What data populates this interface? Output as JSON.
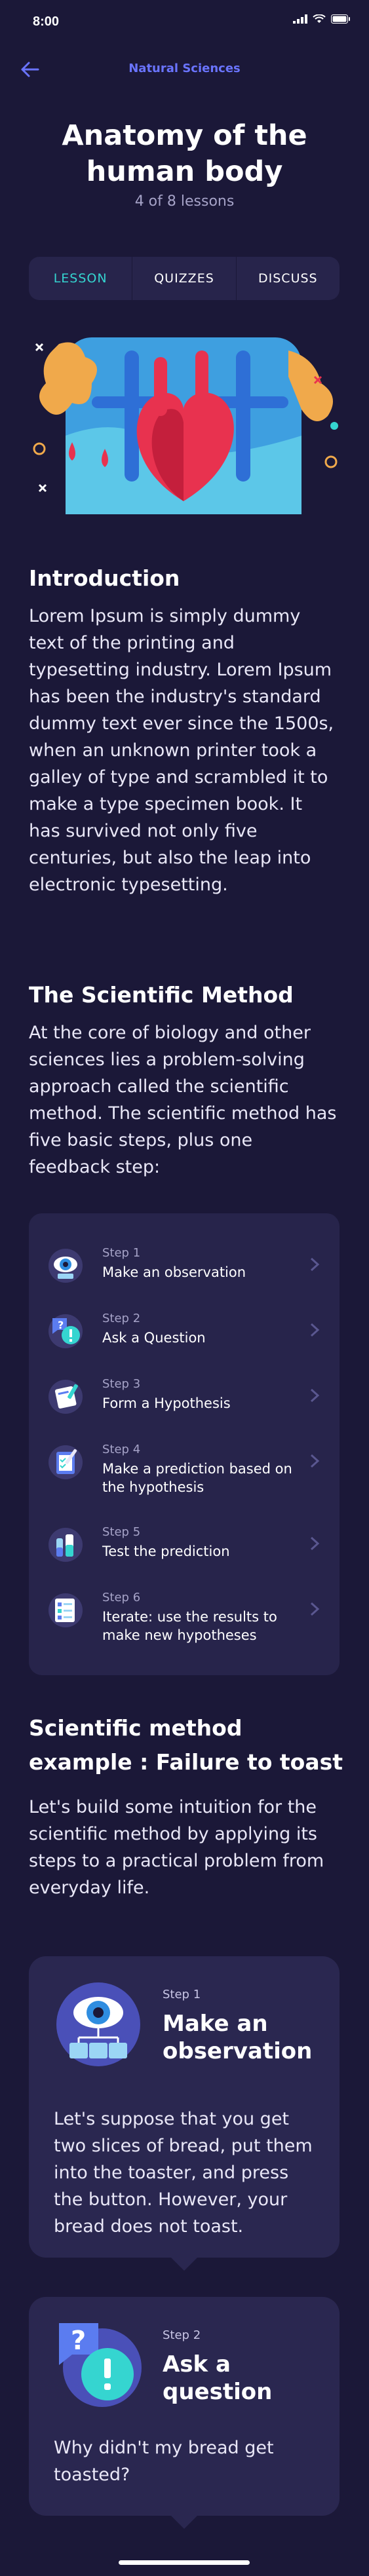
{
  "status_bar": {
    "time": "8:00"
  },
  "nav": {
    "title": "Natural Sciences"
  },
  "lesson": {
    "title": "Anatomy of the human body",
    "progress": "4 of 8 lessons"
  },
  "tabs": [
    {
      "label": "LESSON",
      "active": true
    },
    {
      "label": "QUIZZES",
      "active": false
    },
    {
      "label": "DISCUSS",
      "active": false
    }
  ],
  "intro": {
    "heading": "Introduction",
    "body": "Lorem Ipsum is simply dummy text of the printing and typesetting industry. Lorem Ipsum has been the industry's standard dummy text ever since the 1500s, when an unknown printer took a galley of type and scrambled it to make a type specimen book. It has survived not only five centuries, but also the leap into electronic typesetting."
  },
  "method": {
    "heading": "The Scientific Method",
    "body": "At the core of biology and other sciences lies a problem-solving approach called the scientific method. The scientific method has five basic steps, plus one feedback step:",
    "steps": [
      {
        "label": "Step 1",
        "text": "Make an observation",
        "icon": "eye-icon"
      },
      {
        "label": "Step 2",
        "text": "Ask a Question",
        "icon": "question-icon"
      },
      {
        "label": "Step 3",
        "text": "Form a Hypothesis",
        "icon": "notebook-icon"
      },
      {
        "label": "Step 4",
        "text": "Make a prediction based on the hypothesis",
        "icon": "checklist-icon"
      },
      {
        "label": "Step 5",
        "text": "Test the prediction",
        "icon": "flask-icon"
      },
      {
        "label": "Step 6",
        "text": "Iterate: use the results to make new hypotheses",
        "icon": "report-icon"
      }
    ]
  },
  "example": {
    "heading": "Scientific method example : Failure to toast",
    "body": "Let's build some intuition for the scientific method by applying its steps to a practical problem from everyday life.",
    "cards": [
      {
        "step": "Step 1",
        "title": "Make an observation",
        "body": "Let's suppose that you get two slices of bread, put them into the toaster, and press the button. However, your bread does not toast."
      },
      {
        "step": "Step 2",
        "title": "Ask a question",
        "body": "Why didn't my bread get toasted?"
      }
    ]
  },
  "colors": {
    "background": "#1b1838",
    "card": "#27244b",
    "accent": "#35d5d0",
    "link": "#6a74ff"
  }
}
